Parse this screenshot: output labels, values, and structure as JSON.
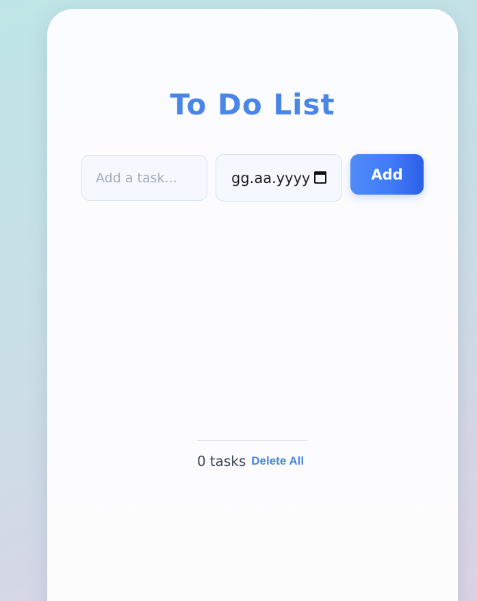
{
  "app": {
    "title": "To Do List"
  },
  "form": {
    "task_placeholder": "Add a task...",
    "task_value": "",
    "date_value": "gg.aa.yyyy",
    "add_label": "Add"
  },
  "footer": {
    "task_count": "0",
    "task_word": "tasks",
    "delete_all_label": "Delete All"
  },
  "tasks": [],
  "colors": {
    "accent": "#4a86e8",
    "button_start": "#4f8bf9",
    "button_end": "#2b5fe6",
    "input_bg": "#f5f8fe"
  },
  "icons": {
    "date_picker": "calendar-icon"
  }
}
